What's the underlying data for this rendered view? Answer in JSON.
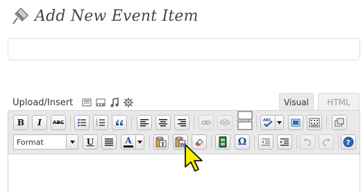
{
  "page": {
    "title": "Add New Event Item"
  },
  "title_input": {
    "value": ""
  },
  "media": {
    "label": "Upload/Insert",
    "icons": [
      "add-image-icon",
      "add-video-icon",
      "add-audio-icon",
      "add-media-icon"
    ]
  },
  "editor_tabs": {
    "visual": "Visual",
    "html": "HTML"
  },
  "toolbar": {
    "format_value": "Format",
    "row1": [
      "bold",
      "italic",
      "strikethrough",
      "bullet-list",
      "numbered-list",
      "blockquote",
      "align-left",
      "align-center",
      "align-right",
      "insert-link",
      "unlink",
      "insert-more",
      "spellcheck",
      "fullscreen",
      "toggle-kitchen-sink",
      "insert-media"
    ],
    "row2": [
      "underline",
      "justify",
      "text-color",
      "paste-as-text",
      "paste-from-word",
      "remove-formatting",
      "insert-video",
      "special-character",
      "outdent",
      "indent",
      "undo",
      "redo",
      "help"
    ],
    "labels": {
      "bold": "B",
      "italic": "I",
      "strike": "ABC",
      "underline": "U",
      "text_color": "A",
      "omega": "Ω"
    }
  },
  "colors": {
    "toolbar_bg": "#e9e9e9",
    "help_blue": "#2a6bb8"
  }
}
